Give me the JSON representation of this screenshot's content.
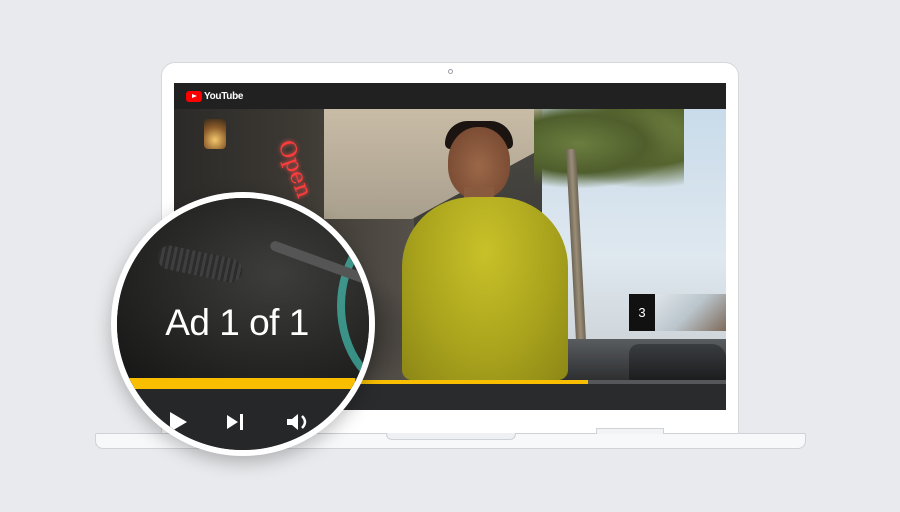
{
  "header": {
    "brand": "YouTube"
  },
  "video": {
    "skip_countdown": "3",
    "progress_fraction": 0.75
  },
  "magnifier": {
    "ad_label": "Ad 1 of 1",
    "progress_fraction": 0.9,
    "controls": {
      "play_icon": "play-icon",
      "next_icon": "skip-next-icon",
      "volume_icon": "volume-icon"
    }
  },
  "colors": {
    "background": "#e9eaed",
    "youtube_red": "#ff0000",
    "ad_progress_yellow": "#f9be00",
    "player_dark": "#212121"
  }
}
